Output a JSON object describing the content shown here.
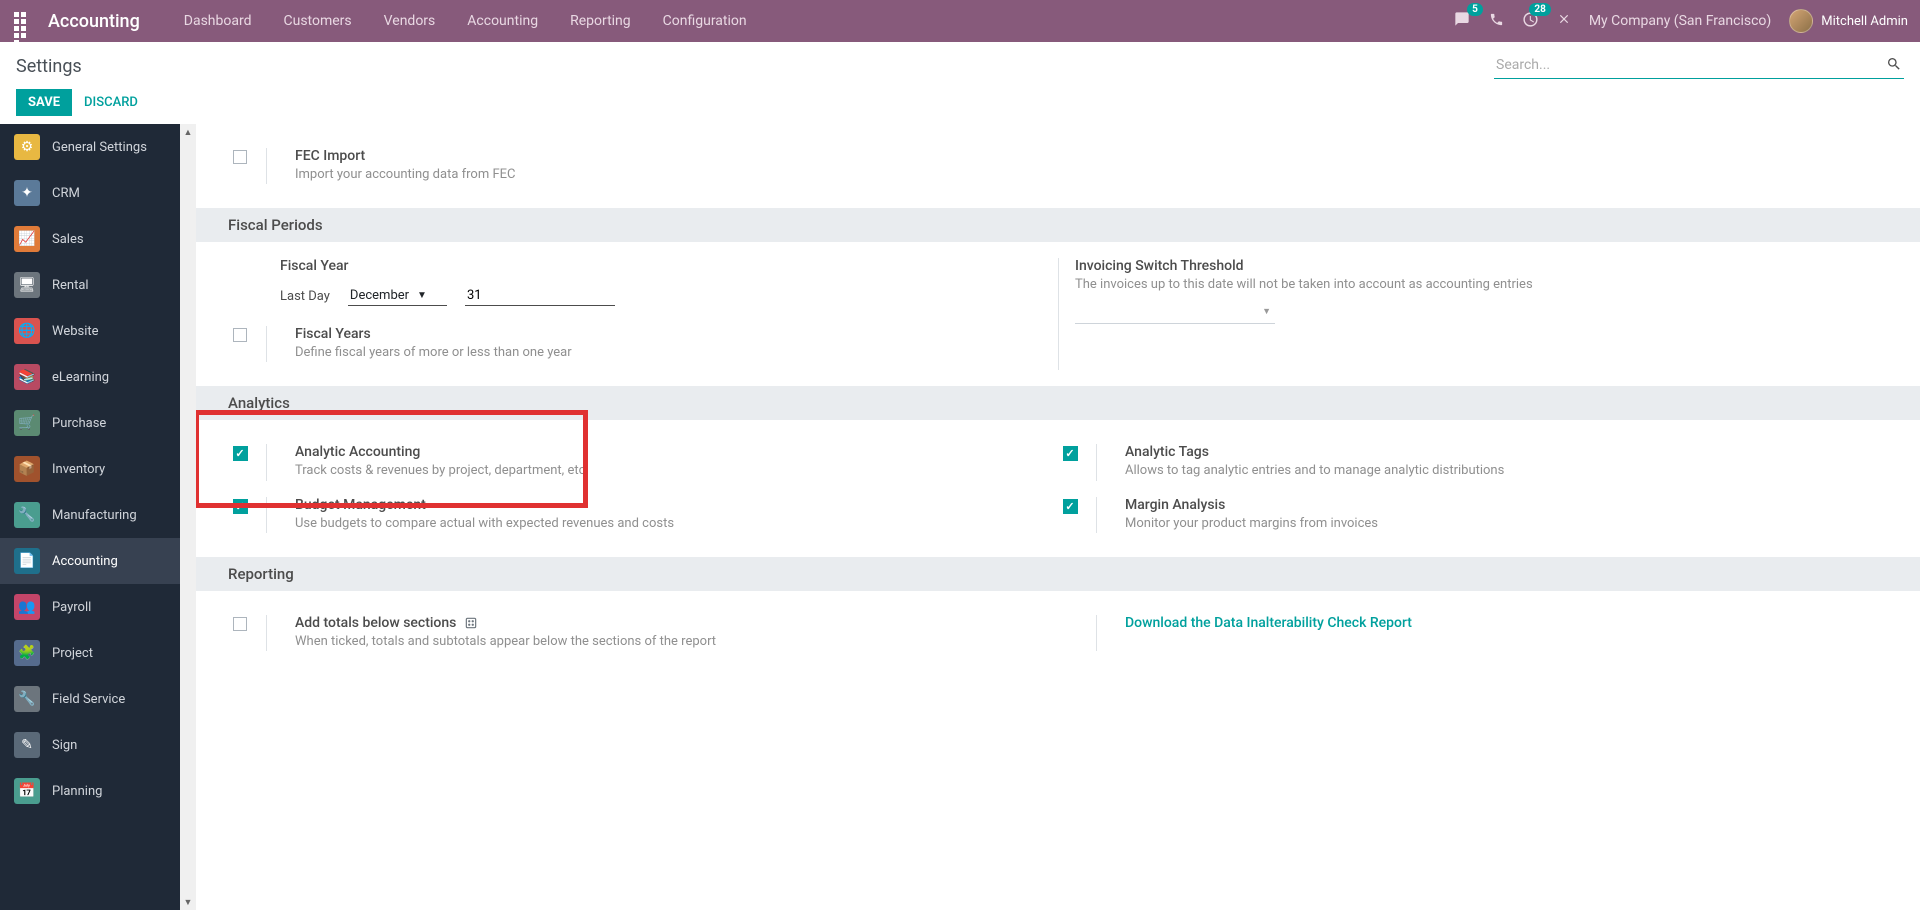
{
  "navbar": {
    "brand": "Accounting",
    "menu": [
      "Dashboard",
      "Customers",
      "Vendors",
      "Accounting",
      "Reporting",
      "Configuration"
    ],
    "messages_badge": "5",
    "activities_badge": "28",
    "company": "My Company (San Francisco)",
    "user": "Mitchell Admin"
  },
  "breadcrumb": "Settings",
  "search_placeholder": "Search...",
  "buttons": {
    "save": "SAVE",
    "discard": "DISCARD"
  },
  "sidebar": [
    {
      "label": "General Settings",
      "color": "#e8b842"
    },
    {
      "label": "CRM",
      "color": "#5b7a99"
    },
    {
      "label": "Sales",
      "color": "#e07b39"
    },
    {
      "label": "Rental",
      "color": "#6c757d"
    },
    {
      "label": "Website",
      "color": "#d9534f"
    },
    {
      "label": "eLearning",
      "color": "#b84a62"
    },
    {
      "label": "Purchase",
      "color": "#5b8a72"
    },
    {
      "label": "Inventory",
      "color": "#a0522d"
    },
    {
      "label": "Manufacturing",
      "color": "#4a9d8f"
    },
    {
      "label": "Accounting",
      "color": "#1f6f8b",
      "active": true
    },
    {
      "label": "Payroll",
      "color": "#c44569"
    },
    {
      "label": "Project",
      "color": "#556b8d"
    },
    {
      "label": "Field Service",
      "color": "#6c757d"
    },
    {
      "label": "Sign",
      "color": "#5a6978"
    },
    {
      "label": "Planning",
      "color": "#4a9d8f"
    }
  ],
  "sections": {
    "fec": {
      "title": "FEC Import",
      "desc": "Import your accounting data from FEC"
    },
    "fiscal_header": "Fiscal Periods",
    "fiscal_year_label": "Fiscal Year",
    "last_day_label": "Last Day",
    "month_value": "December",
    "day_value": "31",
    "invoicing_threshold": {
      "title": "Invoicing Switch Threshold",
      "desc": "The invoices up to this date will not be taken into account as accounting entries"
    },
    "fiscal_years": {
      "title": "Fiscal Years",
      "desc": "Define fiscal years of more or less than one year"
    },
    "analytics_header": "Analytics",
    "analytic_accounting": {
      "title": "Analytic Accounting",
      "desc": "Track costs & revenues by project, department, etc"
    },
    "analytic_tags": {
      "title": "Analytic Tags",
      "desc": "Allows to tag analytic entries and to manage analytic distributions"
    },
    "budget": {
      "title": "Budget Management",
      "desc": "Use budgets to compare actual with expected revenues and costs"
    },
    "margin": {
      "title": "Margin Analysis",
      "desc": "Monitor your product margins from invoices"
    },
    "reporting_header": "Reporting",
    "totals": {
      "title": "Add totals below sections",
      "desc": "When ticked, totals and subtotals appear below the sections of the report"
    },
    "download_link": "Download the Data Inalterability Check Report"
  }
}
